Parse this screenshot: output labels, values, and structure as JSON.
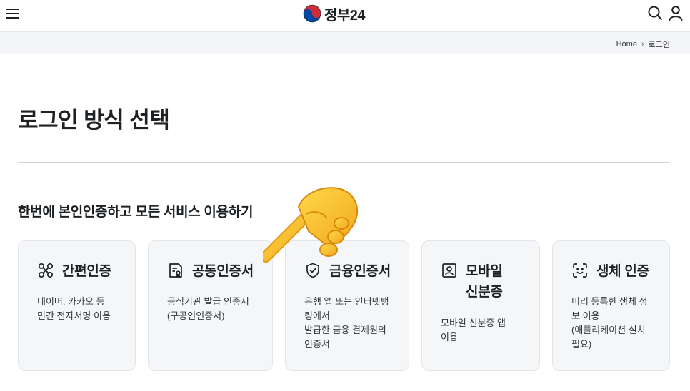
{
  "header": {
    "logo_text": "정부24"
  },
  "breadcrumb": {
    "home": "Home",
    "current": "로그인"
  },
  "page": {
    "title": "로그인 방식 선택",
    "subtitle": "한번에 본인인증하고 모든 서비스 이용하기"
  },
  "cards": [
    {
      "title": "간편인증",
      "icon": "network-nodes-icon",
      "desc": "네이버, 카카오 등\n민간 전자서명 이용"
    },
    {
      "title": "공동인증서",
      "icon": "certificate-icon",
      "desc": "공식기관 발급 인증서\n(구공인인증서)"
    },
    {
      "title": "금융인증서",
      "icon": "shield-check-icon",
      "desc": "은행 앱 또는 인터넷뱅\n킹에서\n발급한 금융 결제원의\n인증서"
    },
    {
      "title": "모바일\n신분증",
      "icon": "id-card-icon",
      "desc": "모바일 신분증 앱\n이용"
    },
    {
      "title": "생체 인증",
      "icon": "face-scan-icon",
      "desc": "미리 등록한 생체 정\n보 이용\n(애플리케이션 설치\n필요)"
    }
  ],
  "colors": {
    "brand_red": "#cd2e3a",
    "brand_blue": "#0047a0",
    "card_bg": "#f5f6f8"
  }
}
